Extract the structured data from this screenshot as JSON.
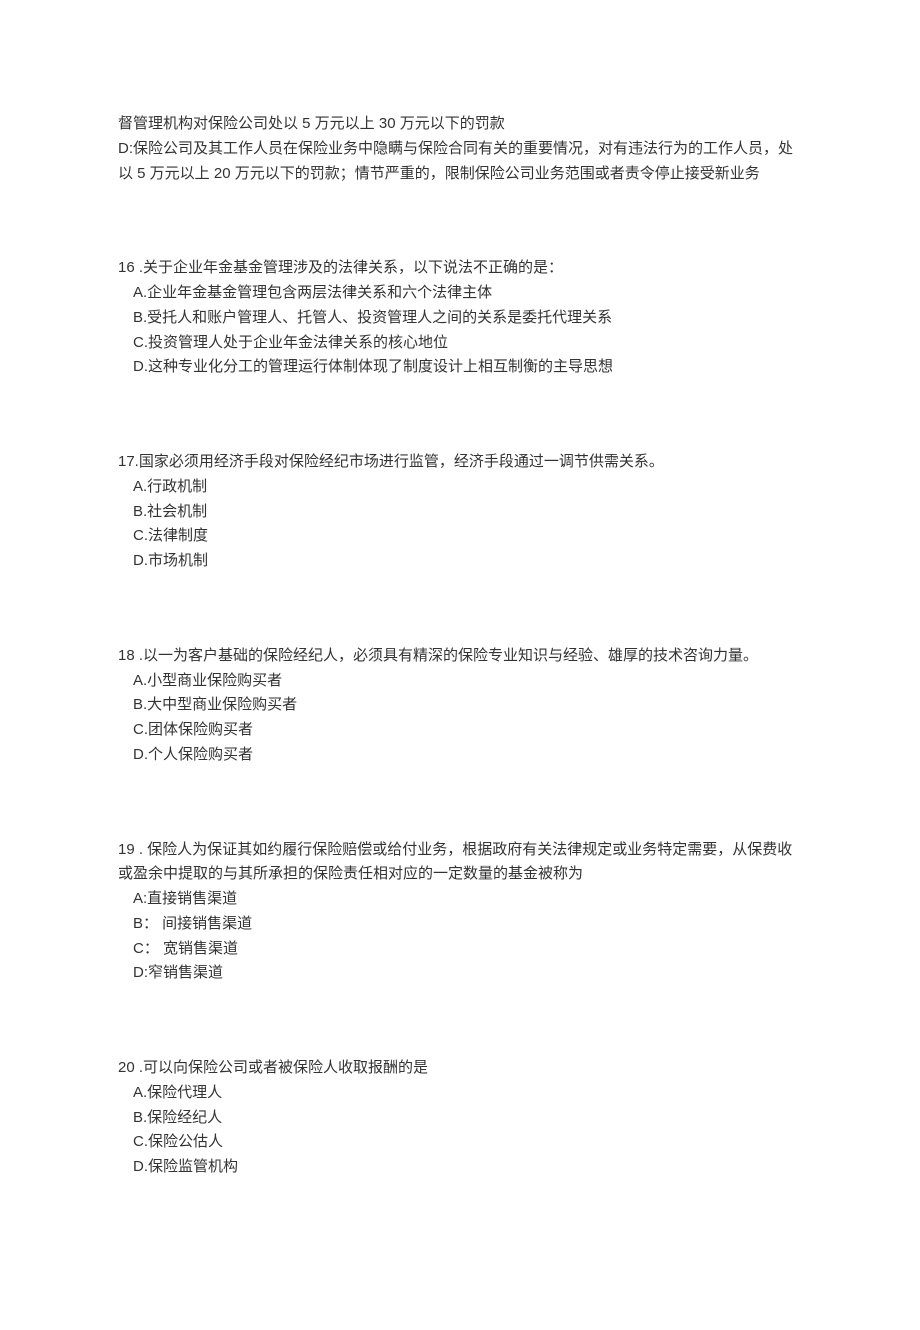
{
  "partial": {
    "line1": "督管理机构对保险公司处以 5 万元以上 30 万元以下的罚款",
    "optD": "D:保险公司及其工作人员在保险业务中隐瞒与保险合同有关的重要情况，对有违法行为的工作人员，处以 5 万元以上 20 万元以下的罚款；情节严重的，限制保险公司业务范围或者责令停止接受新业务"
  },
  "q16": {
    "stem": "16 .关于企业年金基金管理涉及的法律关系，以下说法不正确的是：",
    "A": "A.企业年金基金管理包含两层法律关系和六个法律主体",
    "B": "B.受托人和账户管理人、托管人、投资管理人之间的关系是委托代理关系",
    "C": "C.投资管理人处于企业年金法律关系的核心地位",
    "D": "D.这种专业化分工的管理运行体制体现了制度设计上相互制衡的主导思想"
  },
  "q17": {
    "stem": "17.国家必须用经济手段对保险经纪市场进行监管，经济手段通过一调节供需关系。",
    "A": "A.行政机制",
    "B": "B.社会机制",
    "C": "C.法律制度",
    "D": "D.市场机制"
  },
  "q18": {
    "stem": "18 .以一为客户基础的保险经纪人，必须具有精深的保险专业知识与经验、雄厚的技术咨询力量。",
    "A": "A.小型商业保险购买者",
    "B": "B.大中型商业保险购买者",
    "C": "C.团体保险购买者",
    "D": "D.个人保险购买者"
  },
  "q19": {
    "stem": "19 . 保险人为保证其如约履行保险赔偿或给付业务，根据政府有关法律规定或业务特定需要，从保费收或盈余中提取的与其所承担的保险责任相对应的一定数量的基金被称为",
    "A": "A:直接销售渠道",
    "B": "B： 间接销售渠道",
    "C": "C： 宽销售渠道",
    "D": "D:窄销售渠道"
  },
  "q20": {
    "stem": "20 .可以向保险公司或者被保险人收取报酬的是",
    "A": "A.保险代理人",
    "B": "B.保险经纪人",
    "C": "C.保险公估人",
    "D": "D.保险监管机构"
  }
}
